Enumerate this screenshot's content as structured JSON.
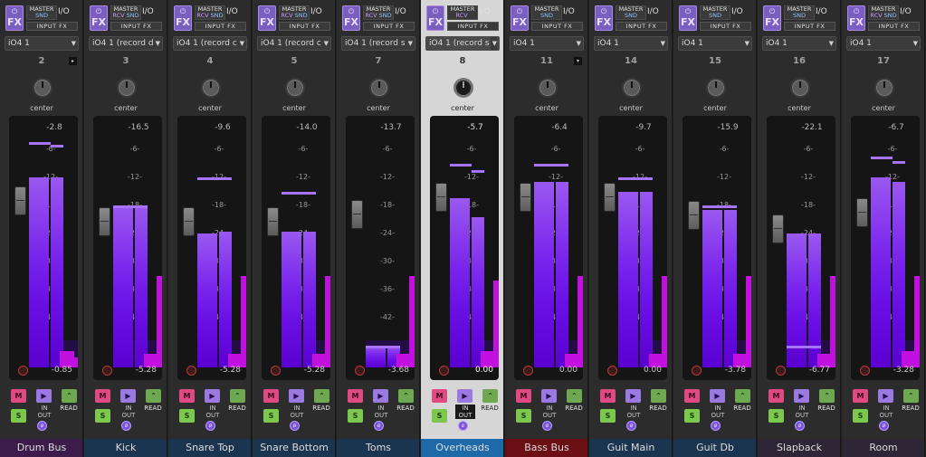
{
  "labels": {
    "fx": "FX",
    "master": "MASTER",
    "rcv": "RCV",
    "snd": "SND",
    "io": "I/O",
    "inputfx": "INPUT FX",
    "center": "center",
    "mute": "M",
    "solo": "S",
    "in": "IN",
    "out": "OUT",
    "read": "READ",
    "scale": [
      "-6-",
      "-12-",
      "-18-",
      "-24-",
      "-30-",
      "-36-",
      "-42-"
    ]
  },
  "colors": {
    "meter": "#7a26ec",
    "peak": "#a873ff",
    "clip": "#c210e0",
    "mute": "#e04a82",
    "solo": "#7cc84e"
  },
  "tracks": [
    {
      "name": "Drum Bus",
      "num": "2",
      "input": "iO4 1",
      "readout": "-2.8",
      "fader_value": "-0.85",
      "meter_db": [
        -12,
        -12
      ],
      "peak_db": [
        -4.5,
        -5
      ],
      "fader_db": -0.85,
      "mag": [
        0.1,
        0.07
      ],
      "name_bg": "#3b1c4a",
      "tri": "▸",
      "flags": {
        "rcv": false,
        "snd": true
      },
      "selected": false
    },
    {
      "name": "Kick",
      "num": "3",
      "input": "iO4 1 (record d",
      "readout": "-16.5",
      "fader_value": "-5.28",
      "meter_db": [
        -18,
        -18
      ],
      "peak_db": [
        -18,
        -18
      ],
      "fader_db": -5.28,
      "mag": [
        0.08,
        0.63
      ],
      "name_bg": "#1b3550",
      "tri": "",
      "flags": {
        "rcv": true,
        "snd": true
      },
      "selected": false
    },
    {
      "name": "Snare Top",
      "num": "4",
      "input": "iO4 1 (record c",
      "readout": "-9.6",
      "fader_value": "-5.28",
      "meter_db": [
        -24,
        -23.5
      ],
      "peak_db": [
        -12,
        -12
      ],
      "fader_db": -5.28,
      "mag": [
        0.08,
        0.63
      ],
      "name_bg": "#1b3550",
      "tri": "",
      "flags": {
        "rcv": true,
        "snd": true
      },
      "selected": false
    },
    {
      "name": "Snare Bottom",
      "num": "5",
      "input": "iO4 1 (record c",
      "readout": "-14.0",
      "fader_value": "-5.28",
      "meter_db": [
        -23.5,
        -23.5
      ],
      "peak_db": [
        -15,
        -15
      ],
      "fader_db": -5.28,
      "mag": [
        0.08,
        0.63
      ],
      "name_bg": "#1b3550",
      "tri": "",
      "flags": {
        "rcv": true,
        "snd": true
      },
      "selected": false
    },
    {
      "name": "Toms",
      "num": "7",
      "input": "iO4 1 (record s",
      "readout": "-13.7",
      "fader_value": "-3.68",
      "meter_db": [
        -48,
        -48
      ],
      "peak_db": [
        -48,
        -48
      ],
      "fader_db": -3.68,
      "mag": [
        0.08,
        0.63
      ],
      "name_bg": "#1b3550",
      "tri": "",
      "flags": {
        "rcv": true,
        "snd": true
      },
      "selected": false
    },
    {
      "name": "Overheads",
      "num": "8",
      "input": "iO4 1 (record s",
      "readout": "-5.7",
      "fader_value": "0.00",
      "meter_db": [
        -16.5,
        -20.5
      ],
      "peak_db": [
        -9,
        -10.5
      ],
      "fader_db": 0,
      "mag": [
        0.1,
        0.6
      ],
      "name_bg": "#1e6aa8",
      "tri": "",
      "flags": {
        "rcv": true,
        "snd": false
      },
      "selected": true
    },
    {
      "name": "Bass Bus",
      "num": "11",
      "input": "iO4 1",
      "readout": "-6.4",
      "fader_value": "0.00",
      "meter_db": [
        -13,
        -13
      ],
      "peak_db": [
        -9,
        -9
      ],
      "fader_db": 0,
      "mag": [
        0.08,
        0.63
      ],
      "name_bg": "#6b0f14",
      "tri": "▾",
      "flags": {
        "rcv": false,
        "snd": true
      },
      "selected": false
    },
    {
      "name": "Guit Main",
      "num": "14",
      "input": "iO4 1",
      "readout": "-9.7",
      "fader_value": "0.00",
      "meter_db": [
        -15,
        -15
      ],
      "peak_db": [
        -12,
        -12
      ],
      "fader_db": 0,
      "mag": [
        0.08,
        0.63
      ],
      "name_bg": "#1b3550",
      "tri": "",
      "flags": {
        "rcv": false,
        "snd": true
      },
      "selected": false
    },
    {
      "name": "Guit Db",
      "num": "15",
      "input": "iO4 1",
      "readout": "-15.9",
      "fader_value": "-3.78",
      "meter_db": [
        -19,
        -19
      ],
      "peak_db": [
        -18,
        -18
      ],
      "fader_db": -3.78,
      "mag": [
        0.08,
        0.63
      ],
      "name_bg": "#1b3550",
      "tri": "",
      "flags": {
        "rcv": false,
        "snd": true
      },
      "selected": false
    },
    {
      "name": "Slapback",
      "num": "16",
      "input": "iO4 1",
      "readout": "-22.1",
      "fader_value": "-6.77",
      "meter_db": [
        -24,
        -24
      ],
      "peak_db": [
        -48,
        -48
      ],
      "fader_db": -6.77,
      "mag": [
        0.08,
        0.63
      ],
      "name_bg": "#2e2536",
      "tri": "",
      "flags": {
        "rcv": false,
        "snd": true
      },
      "selected": false
    },
    {
      "name": "Room",
      "num": "17",
      "input": "iO4 1",
      "readout": "-6.7",
      "fader_value": "-3.28",
      "meter_db": [
        -12,
        -13
      ],
      "peak_db": [
        -7.5,
        -8.5
      ],
      "fader_db": -3.28,
      "mag": [
        0.1,
        0.63
      ],
      "name_bg": "#2e2536",
      "tri": "",
      "flags": {
        "rcv": true,
        "snd": true
      },
      "selected": false
    }
  ]
}
